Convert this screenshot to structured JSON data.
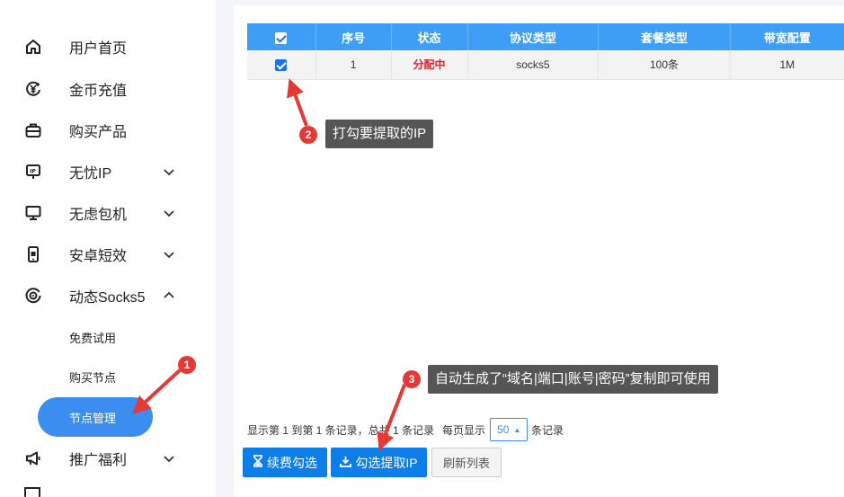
{
  "sidebar": {
    "items": [
      {
        "label": "用户首页",
        "icon": "home-icon",
        "chevron": ""
      },
      {
        "label": "金币充值",
        "icon": "coin-icon",
        "chevron": ""
      },
      {
        "label": "购买产品",
        "icon": "briefcase-icon",
        "chevron": ""
      },
      {
        "label": "无忧IP",
        "icon": "ip-sign-icon",
        "chevron": "down"
      },
      {
        "label": "无虑包机",
        "icon": "monitor-icon",
        "chevron": "down"
      },
      {
        "label": "安卓短效",
        "icon": "phone-icon",
        "chevron": "down"
      },
      {
        "label": "动态Socks5",
        "icon": "target-icon",
        "chevron": "up"
      }
    ],
    "sub_items": [
      {
        "label": "免费试用",
        "active": false
      },
      {
        "label": "购买节点",
        "active": false
      },
      {
        "label": "节点管理",
        "active": true
      }
    ],
    "after_items": [
      {
        "label": "推广福利",
        "icon": "megaphone-icon",
        "chevron": "down"
      }
    ]
  },
  "table": {
    "headers": [
      "序号",
      "状态",
      "协议类型",
      "套餐类型",
      "带宽配置"
    ],
    "rows": [
      {
        "index": "1",
        "status": "分配中",
        "protocol": "socks5",
        "package": "100条",
        "bandwidth": "1M",
        "checked": true
      }
    ],
    "header_checked": true
  },
  "pager": {
    "summary": "显示第 1 到第 1 条记录，总共 1 条记录",
    "per_page_prefix": "每页显示",
    "per_page_value": "50",
    "per_page_suffix": "条记录"
  },
  "buttons": {
    "renew": "续费勾选",
    "extract": "勾选提取IP",
    "refresh": "刷新列表"
  },
  "annotations": [
    {
      "num": "1",
      "text": ""
    },
    {
      "num": "2",
      "text": "打勾要提取的IP"
    },
    {
      "num": "3",
      "text": "自动生成了“域名|端口|账号|密码”复制即可使用"
    }
  ],
  "colors": {
    "accent": "#3b8ef0",
    "header_blue": "#3e9df5",
    "button_blue": "#0d7ee8",
    "status_red": "#d9262c",
    "annotation_red": "#e53935",
    "tooltip_bg": "#555555"
  }
}
